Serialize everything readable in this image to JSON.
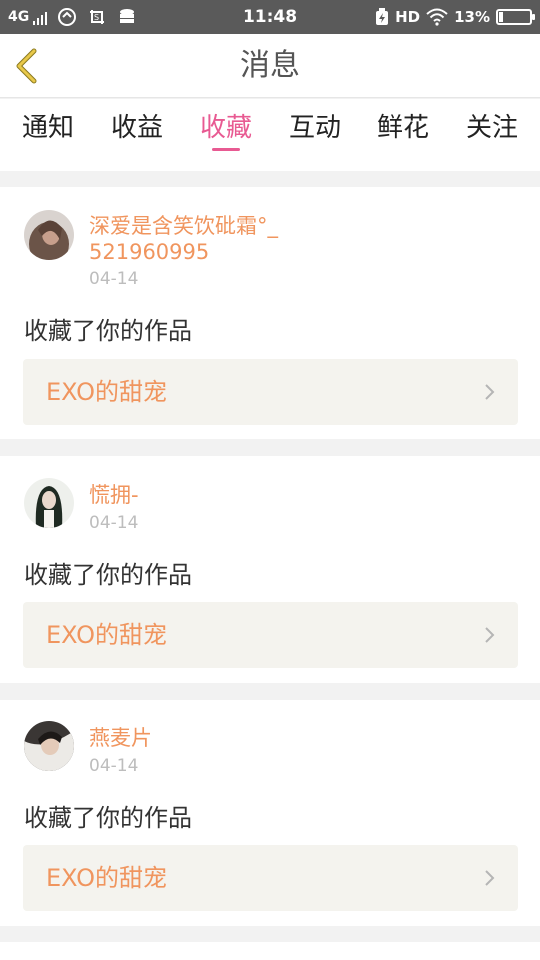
{
  "status_bar": {
    "network": "4G",
    "time": "11:48",
    "hd": "HD",
    "battery": "13%"
  },
  "header": {
    "title": "消息"
  },
  "tabs": [
    {
      "label": "通知"
    },
    {
      "label": "收益"
    },
    {
      "label": "收藏",
      "active": true
    },
    {
      "label": "互动"
    },
    {
      "label": "鲜花"
    },
    {
      "label": "关注"
    }
  ],
  "feed": [
    {
      "username": "深爱是含笑饮砒霜°_521960995",
      "date": "04-14",
      "action": "收藏了你的作品",
      "work_title": "EXO的甜宠"
    },
    {
      "username": "慌拥-",
      "date": "04-14",
      "action": "收藏了你的作品",
      "work_title": "EXO的甜宠"
    },
    {
      "username": "燕麦片",
      "date": "04-14",
      "action": "收藏了你的作品",
      "work_title": "EXO的甜宠"
    }
  ],
  "colors": {
    "accent_pink": "#e85a92",
    "accent_orange": "#f0955e",
    "status_bar": "#5a5a5a"
  },
  "icons": {
    "back": "chevron-left-icon",
    "item_chevron": "chevron-right-icon"
  }
}
